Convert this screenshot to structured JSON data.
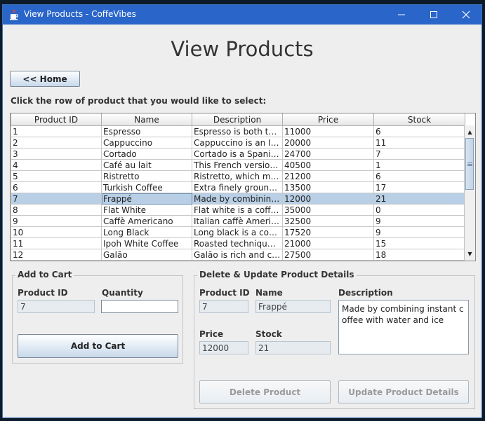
{
  "window": {
    "title": "View Products - CoffeVibes"
  },
  "page": {
    "heading": "View Products",
    "home_button": "<< Home",
    "instruction": "Click the row of product that you would like to select:"
  },
  "table": {
    "columns": [
      "Product ID",
      "Name",
      "Description",
      "Price",
      "Stock"
    ],
    "rows": [
      [
        "1",
        "Espresso",
        "Espresso is both the ...",
        "11000",
        "6"
      ],
      [
        "2",
        "Cappuccino",
        "Cappuccino is an Ital...",
        "20000",
        "11"
      ],
      [
        "3",
        "Cortado",
        "Cortado is a Spanish...",
        "24700",
        "7"
      ],
      [
        "4",
        "Café au lait",
        "This French version ...",
        "40500",
        "1"
      ],
      [
        "5",
        "Ristretto",
        "Ristretto, which mea...",
        "21200",
        "6"
      ],
      [
        "6",
        "Turkish Coffee",
        "Extra finely ground ro...",
        "13500",
        "17"
      ],
      [
        "7",
        "Frappé",
        "Made by combining i...",
        "12000",
        "21"
      ],
      [
        "8",
        "Flat White",
        "Flat white is a coffee ...",
        "35000",
        "0"
      ],
      [
        "9",
        "Caffè Americano",
        "Italian caffè American...",
        "32500",
        "9"
      ],
      [
        "10",
        "Long Black",
        "Long black is a coffe...",
        "17520",
        "9"
      ],
      [
        "11",
        "Ipoh White Coffee",
        "Roasted technique in...",
        "21000",
        "15"
      ],
      [
        "12",
        "Galão",
        "Galão is rich and cre...",
        "27500",
        "18"
      ]
    ],
    "selected_row": 6
  },
  "cart": {
    "title": "Add to Cart",
    "product_id_label": "Product ID",
    "quantity_label": "Quantity",
    "product_id_value": "7",
    "quantity_value": "",
    "add_button": "Add to Cart"
  },
  "details": {
    "title": "Delete & Update Product Details",
    "product_id_label": "Product ID",
    "name_label": "Name",
    "description_label": "Description",
    "price_label": "Price",
    "stock_label": "Stock",
    "product_id_value": "7",
    "name_value": "Frappé",
    "description_value": "Made by combining instant coffee with water and ice",
    "price_value": "12000",
    "stock_value": "21",
    "delete_button": "Delete Product",
    "update_button": "Update Product Details"
  },
  "icons": {
    "app": "java-cup-icon",
    "minimize": "minimize-icon",
    "maximize": "maximize-icon",
    "close": "close-icon"
  }
}
